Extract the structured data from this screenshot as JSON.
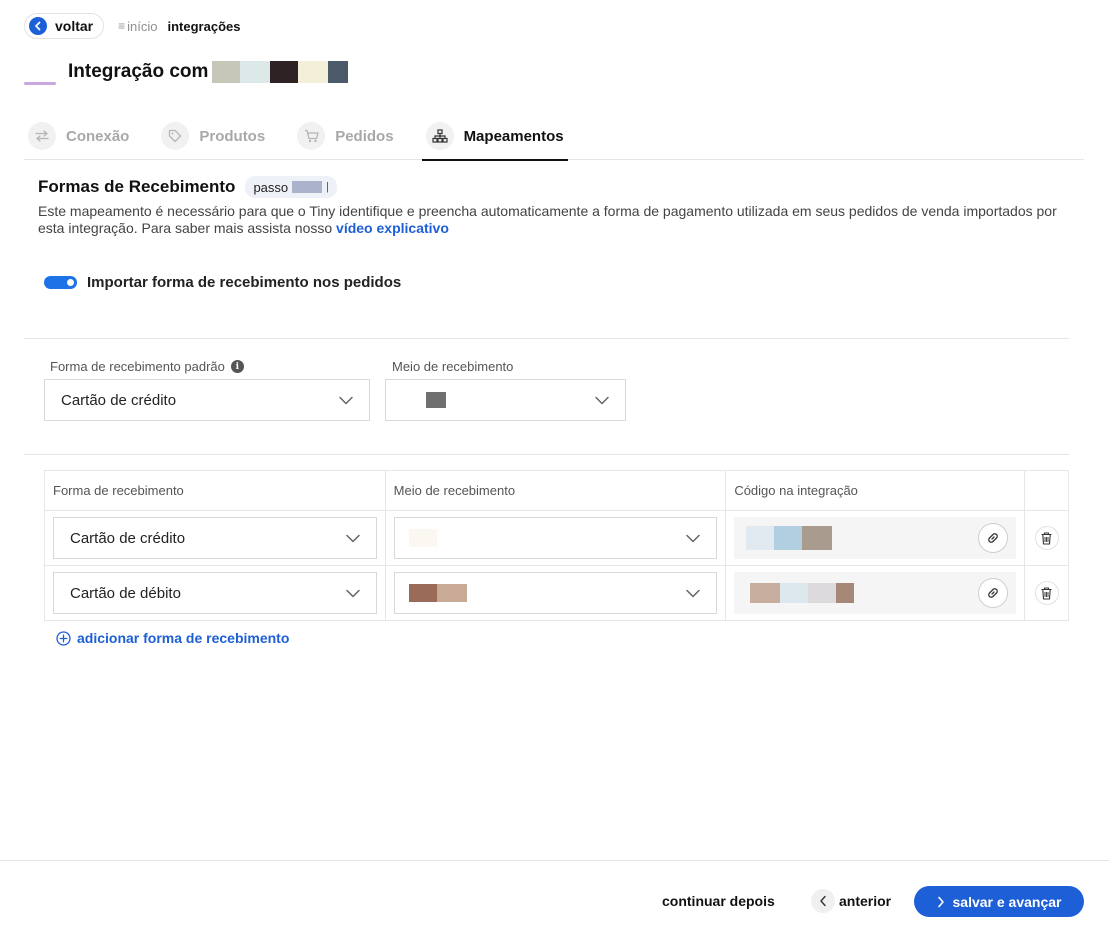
{
  "topbar": {
    "back_label": "voltar",
    "home_label": "início",
    "current_label": "integrações"
  },
  "header": {
    "title": "Integração com"
  },
  "tabs": [
    {
      "label": "Conexão",
      "icon": "arrows-icon",
      "active": false
    },
    {
      "label": "Produtos",
      "icon": "tag-icon",
      "active": false
    },
    {
      "label": "Pedidos",
      "icon": "cart-icon",
      "active": false
    },
    {
      "label": "Mapeamentos",
      "icon": "sitemap-icon",
      "active": true
    }
  ],
  "section": {
    "title": "Formas de Recebimento",
    "step_label": "passo",
    "description_text": "Este mapeamento é necessário para que o Tiny identifique e preencha automaticamente a forma de pagamento utilizada em seus pedidos de venda importados por esta integração. Para saber mais assista nosso ",
    "description_link": "vídeo explicativo"
  },
  "toggle": {
    "label": "Importar forma de recebimento nos pedidos",
    "on": true
  },
  "defaults": {
    "form_label": "Forma de recebimento padrão",
    "form_value": "Cartão de crédito",
    "means_label": "Meio de recebimento"
  },
  "table": {
    "headers": [
      "Forma de recebimento",
      "Meio de recebimento",
      "Código na integração"
    ],
    "rows": [
      {
        "form": "Cartão de crédito"
      },
      {
        "form": "Cartão de débito"
      }
    ]
  },
  "add_label": "adicionar forma de recebimento",
  "footer": {
    "later_label": "continuar depois",
    "prev_label": "anterior",
    "next_label": "salvar e avançar"
  },
  "colors": {
    "accent": "#1d5fd6",
    "toggle": "#1d72e8"
  }
}
